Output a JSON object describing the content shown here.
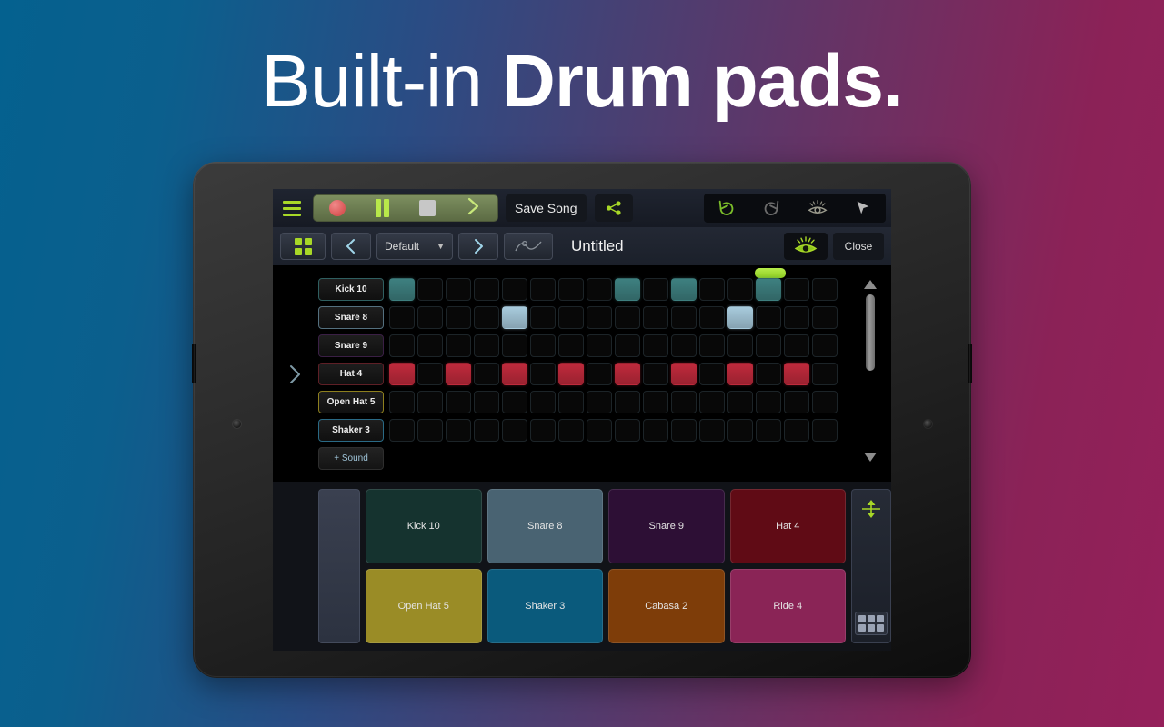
{
  "headline": {
    "light": "Built-in ",
    "bold": "Drum pads",
    "period": "."
  },
  "colors": {
    "bg_left": "#04618f",
    "bg_right": "#95205a",
    "accent_green": "#a8d827",
    "record_red": "#d95555",
    "chevron_blue": "#9fd4e8"
  },
  "toolbar_main": {
    "menu_icon": "hamburger-icon",
    "transport": {
      "record_icon": "record-icon",
      "pause_icon": "pause-icon",
      "stop_icon": "stop-icon",
      "next_icon": "chevron-right-icon"
    },
    "save_label": "Save Song",
    "share_icon": "share-icon",
    "undo_icon": "undo-icon",
    "redo_icon": "redo-icon",
    "eye_icon": "eye-icon",
    "cursor_icon": "cursor-arrow-icon"
  },
  "toolbar_secondary": {
    "grid_icon": "grid-icon",
    "prev_icon": "chevron-left-icon",
    "preset_value": "Default",
    "preset_caret": "▼",
    "next_icon": "chevron-right-icon",
    "automation_icon": "automation-curve-icon",
    "song_title": "Untitled",
    "eye_icon": "eye-visible-icon",
    "close_label": "Close"
  },
  "sequencer": {
    "expand_icon": "chevron-right-icon",
    "add_sound_label": "+ Sound",
    "steps": 16,
    "playhead_step": 14,
    "scroll_up_icon": "triangle-up-icon",
    "scroll_down_icon": "triangle-down-icon",
    "tracks": [
      {
        "name": "Kick 10",
        "color": "#3e8080",
        "border": "#2f5f60",
        "steps": [
          1,
          0,
          0,
          0,
          0,
          0,
          0,
          0,
          1,
          0,
          1,
          0,
          0,
          1,
          0,
          0
        ]
      },
      {
        "name": "Snare 8",
        "color": "#a8cbdd",
        "border": "#54707f",
        "steps": [
          0,
          0,
          0,
          0,
          1,
          0,
          0,
          0,
          0,
          0,
          0,
          0,
          1,
          0,
          0,
          0
        ]
      },
      {
        "name": "Snare 9",
        "color": "#4a2a57",
        "border": "#3a1f45",
        "steps": [
          0,
          0,
          0,
          0,
          0,
          0,
          0,
          0,
          0,
          0,
          0,
          0,
          0,
          0,
          0,
          0
        ]
      },
      {
        "name": "Hat 4",
        "color": "#c02a3c",
        "border": "#5e1f26",
        "steps": [
          1,
          0,
          1,
          0,
          1,
          0,
          1,
          0,
          1,
          0,
          1,
          0,
          1,
          0,
          1,
          0
        ]
      },
      {
        "name": "Open Hat 5",
        "color": "#a59421",
        "border": "#8d7f1e",
        "steps": [
          0,
          0,
          0,
          0,
          0,
          0,
          0,
          0,
          0,
          0,
          0,
          0,
          0,
          0,
          0,
          0
        ]
      },
      {
        "name": "Shaker 3",
        "color": "#0b5e7e",
        "border": "#2a6a85",
        "steps": [
          0,
          0,
          0,
          0,
          0,
          0,
          0,
          0,
          0,
          0,
          0,
          0,
          0,
          0,
          0,
          0
        ]
      }
    ]
  },
  "pads": {
    "velocity_strip": "velocity-strip",
    "resize_icon": "resize-vertical-icon",
    "layout_icon": "pad-layout-icon",
    "items": [
      {
        "label": "Kick 10",
        "color": "#15332f"
      },
      {
        "label": "Snare 8",
        "color": "#496372"
      },
      {
        "label": "Snare 9",
        "color": "#2d0f35"
      },
      {
        "label": "Hat 4",
        "color": "#600b15"
      },
      {
        "label": "Open Hat 5",
        "color": "#9a8c26"
      },
      {
        "label": "Shaker 3",
        "color": "#0a5a7c"
      },
      {
        "label": "Cabasa 2",
        "color": "#7e3d09"
      },
      {
        "label": "Ride 4",
        "color": "#8a2456"
      }
    ]
  }
}
